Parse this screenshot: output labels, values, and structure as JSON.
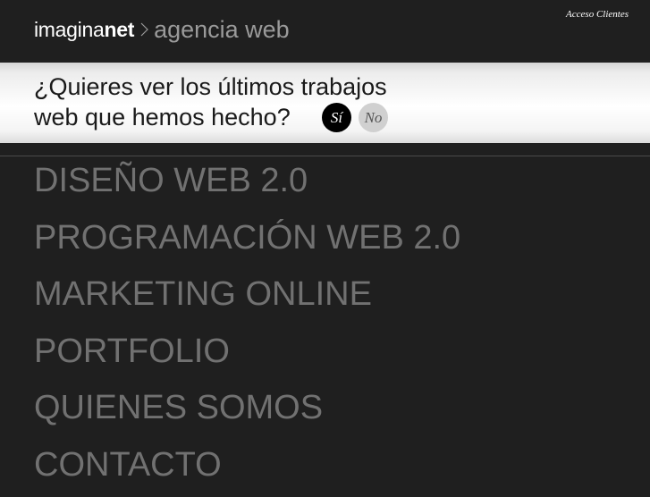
{
  "header": {
    "logo_light": "imagina",
    "logo_bold": "net",
    "logo_chevron_icon": "chevron-right-icon",
    "tagline": "agencia web",
    "access_link": "Acceso Clientes"
  },
  "banner": {
    "question_line1": "¿Quieres ver los últimos trabajos",
    "question_line2": "web que hemos hecho?",
    "yes_label": "Sí",
    "no_label": "No"
  },
  "nav": {
    "items": [
      {
        "label": "DISEÑO WEB 2.0"
      },
      {
        "label": "PROGRAMACIÓN WEB 2.0"
      },
      {
        "label": "MARKETING ONLINE"
      },
      {
        "label": "PORTFOLIO"
      },
      {
        "label": "QUIENES SOMOS"
      },
      {
        "label": "CONTACTO"
      }
    ]
  },
  "colors": {
    "background": "#1f1f1f",
    "nav_text": "#717171",
    "tagline": "#9a9a9a",
    "yes_button": "#000000",
    "no_button": "#d0d0d0"
  }
}
